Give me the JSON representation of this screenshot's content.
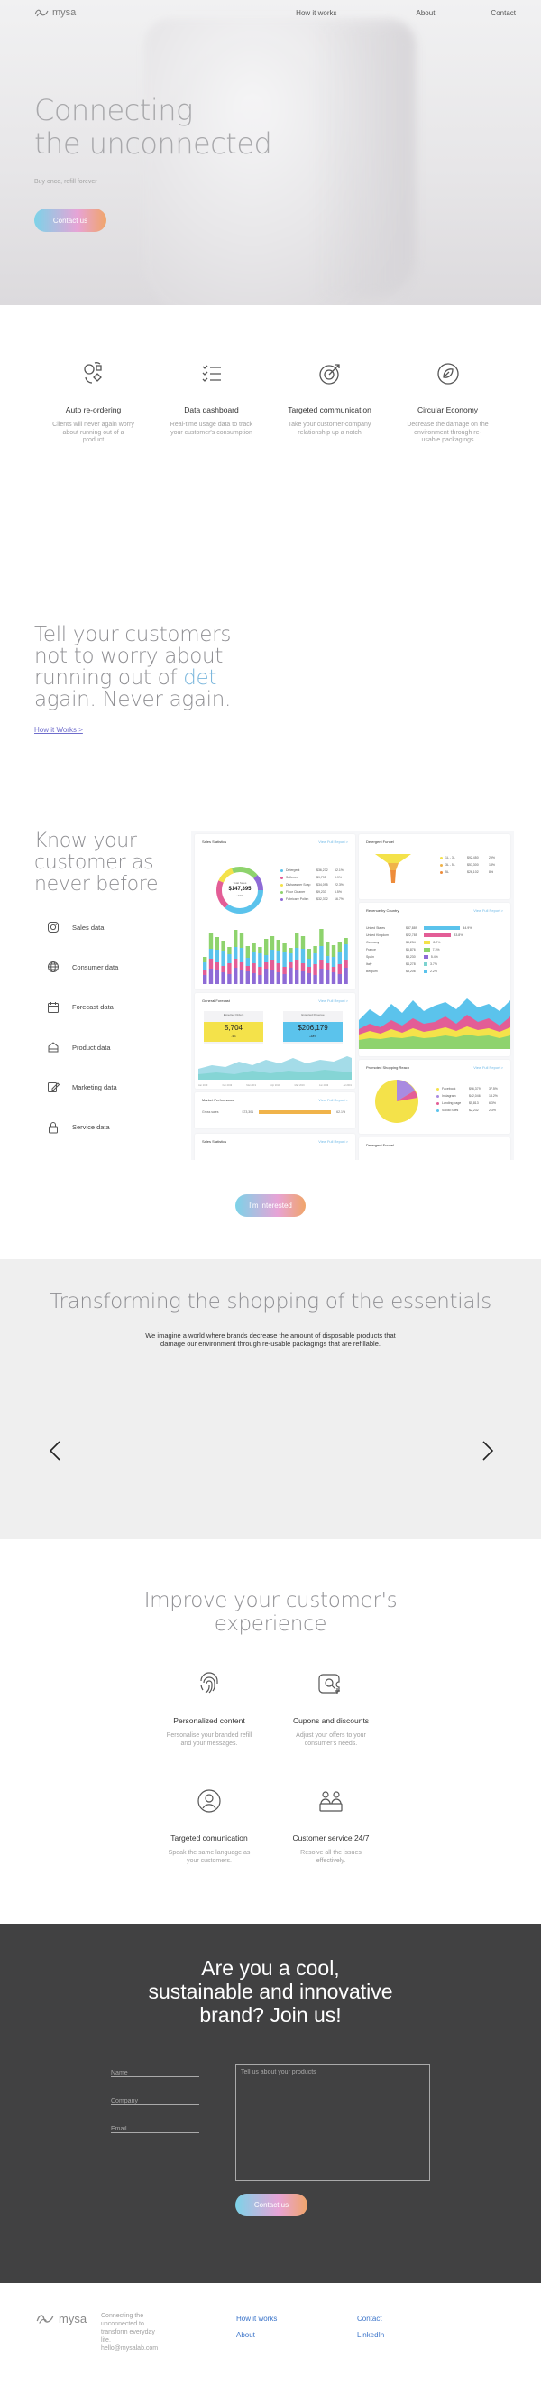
{
  "nav": {
    "logo_text": "mysa",
    "links": [
      "How it works",
      "About",
      "Contact"
    ]
  },
  "hero": {
    "title_line1": "Connecting",
    "title_line2": "the unconnected",
    "subtitle": "Buy once, refill forever",
    "cta": "Contact us"
  },
  "features": [
    {
      "icon": "cycle-icon",
      "title": "Auto re-ordering",
      "desc": "Clients will never again worry about running out of a product"
    },
    {
      "icon": "list-icon",
      "title": "Data dashboard",
      "desc": "Real-time usage data to track your customer's consumption"
    },
    {
      "icon": "target-icon",
      "title": "Targeted communication",
      "desc": "Take your customer-company relationship up a notch"
    },
    {
      "icon": "leaf-icon",
      "title": "Circular Economy",
      "desc": "Decrease the damage on the environment through re-usable packagings"
    }
  ],
  "tell": {
    "line1": "Tell your customers",
    "line2": "not to worry about",
    "line3": "running out of",
    "word": "det",
    "line4": "again. Never again.",
    "link": "How it Works >"
  },
  "know": {
    "line1": "Know your",
    "line2": "customer as",
    "line3": "never before",
    "items": [
      {
        "icon": "instagram-icon",
        "label": "Sales data"
      },
      {
        "icon": "globe-icon",
        "label": "Consumer data"
      },
      {
        "icon": "calendar-icon",
        "label": "Forecast data"
      },
      {
        "icon": "box-icon",
        "label": "Product data"
      },
      {
        "icon": "edit-icon",
        "label": "Marketing data"
      },
      {
        "icon": "lock-icon",
        "label": "Service data"
      }
    ],
    "cta": "I'm interested"
  },
  "dashboard": {
    "sales_title": "Sales Statistics",
    "sales_link": "View Full Report >",
    "total_sales_label": "Total Sales",
    "total_sales": "$147,395",
    "total_sales_change": "+10%",
    "detergent_title": "Detergent Funnel",
    "revenue_title": "Revenue by Country",
    "revenue_link": "View Full Report >",
    "forecast_title": "General Forecast",
    "forecast_link": "View Full Report >",
    "expected_orders_label": "Expected Orders",
    "expected_orders": "5,704",
    "expected_orders_change": "-3%",
    "expected_revenue_label": "Expected Revenue",
    "expected_revenue": "$206,179",
    "expected_revenue_change": "+18%",
    "promoted_title": "Promoted Shopping Reach",
    "promoted_link": "View Full Report >",
    "market_title": "Market Performance",
    "market_link": "View Full Report >",
    "sales_title_2": "Sales Statistics",
    "sales_link_2": "View Full Report >",
    "detergent_title_2": "Detergent Funnel",
    "sales_rows": [
      {
        "name": "Detergent",
        "value": "$36,232",
        "pct": "62.1%"
      },
      {
        "name": "Softener",
        "value": "$9,795",
        "pct": "9.9%"
      },
      {
        "name": "Dishwasher Soap",
        "value": "$34,095",
        "pct": "22.3%"
      },
      {
        "name": "Floor Cleaner",
        "value": "$9,233",
        "pct": "6.5%"
      },
      {
        "name": "Fabricare Polish",
        "value": "$32,372",
        "pct": "16.7%"
      }
    ],
    "funnel_rows": [
      {
        "label": "1L - 3L",
        "value": "$92,450",
        "pct": "29%"
      },
      {
        "label": "3L - 5L",
        "value": "$57,300",
        "pct": "18%"
      },
      {
        "label": "5L",
        "value": "$26,102",
        "pct": "8%"
      }
    ],
    "country_rows": [
      {
        "name": "United States",
        "value": "$37,889",
        "pct": "44.9%"
      },
      {
        "name": "United Kingdom",
        "value": "$22,785",
        "pct": "33.8%"
      },
      {
        "name": "Germany",
        "value": "$8,234",
        "pct": "8.2%"
      },
      {
        "name": "France",
        "value": "$6,876",
        "pct": "7.3%"
      },
      {
        "name": "Spain",
        "value": "$5,230",
        "pct": "5.4%"
      },
      {
        "name": "Italy",
        "value": "$4,278",
        "pct": "3.7%"
      },
      {
        "name": "Belgium",
        "value": "$3,206",
        "pct": "2.2%"
      }
    ],
    "reach_rows": [
      {
        "name": "Facebook",
        "value": "$96,379",
        "pct": "37.5%"
      },
      {
        "name": "Instagram",
        "value": "$42,046",
        "pct": "18.2%"
      },
      {
        "name": "Landing page",
        "value": "$5,813",
        "pct": "6.3%"
      },
      {
        "name": "Social Sites",
        "value": "$2,232",
        "pct": "2.3%"
      }
    ],
    "market_row": {
      "name": "Gross sales",
      "value": "$73,301",
      "pct": "62.1%"
    },
    "timeline": [
      "Jan 2019",
      "Feb 2019",
      "Mar 2019",
      "Apr 2019",
      "May 2019",
      "Jun 2019",
      "Jul 2019"
    ],
    "colors": {
      "blue": "#5bc3ec",
      "pink": "#e35d96",
      "purple": "#8e6bd6",
      "green": "#8ed36d",
      "yellow": "#f4e24a",
      "teal": "#7dd3d0"
    }
  },
  "transform": {
    "title": "Transforming the shopping of the essentials",
    "text": "We imagine a world where brands decrease the amount of disposable products that damage our environment through re-usable packagings that are refillable."
  },
  "improve": {
    "title_line1": "Improve your customer's",
    "title_line2": "experience",
    "items": [
      {
        "icon": "fingerprint-icon",
        "title": "Personalized content",
        "desc": "Personalise your branded refill and your messages."
      },
      {
        "icon": "coupon-icon",
        "title": "Cupons and discounts",
        "desc": "Adjust your offers to your consumer's needs."
      },
      {
        "icon": "person-icon",
        "title": "Targeted comunication",
        "desc": "Speak the same language as your customers."
      },
      {
        "icon": "service-icon",
        "title": "Customer service 24/7",
        "desc": "Resolve all the issues effectively."
      }
    ]
  },
  "join": {
    "title_line1": "Are you a cool,",
    "title_line2": "sustainable and innovative",
    "title_line3": "brand? Join us!",
    "name_placeholder": "Name",
    "company_placeholder": "Company",
    "email_placeholder": "Email",
    "message_placeholder": "Tell us about your products",
    "cta": "Contact us"
  },
  "footer": {
    "logo_text": "mysa",
    "tagline": "Connecting the unconnected to transform everyday life.",
    "email": "hello@mysalab.com",
    "links_col1": [
      "How it works",
      "About"
    ],
    "links_col2": [
      "Contact",
      "LinkedIn"
    ]
  }
}
